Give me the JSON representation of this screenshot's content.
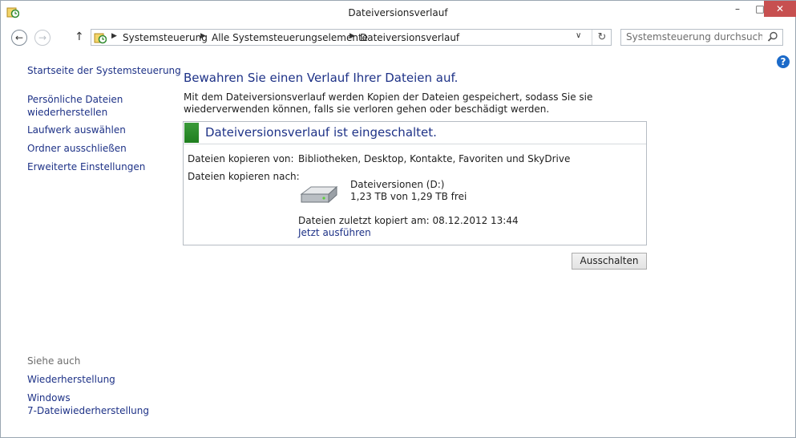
{
  "window": {
    "title": "Dateiversionsverlauf",
    "minimize": "–",
    "maximize": "□",
    "close": "✕"
  },
  "nav": {
    "back": "←",
    "forward": "→",
    "up": "↑",
    "breadcrumbs": [
      "Systemsteuerung",
      "Alle Systemsteuerungselemente",
      "Dateiversionsverlauf"
    ],
    "dropdown": "∨",
    "refresh": "↻",
    "search_placeholder": "Systemsteuerung durchsuchen"
  },
  "help": "?",
  "sidebar": {
    "home": "Startseite der Systemsteuerung",
    "links": [
      "Persönliche Dateien",
      "wiederherstellen",
      "Laufwerk auswählen",
      "Ordner ausschließen",
      "Erweiterte Einstellungen"
    ],
    "see_also": "Siehe auch",
    "see_also_links": [
      "Wiederherstellung",
      "Windows",
      "7-Dateiwiederherstellung"
    ]
  },
  "main": {
    "title": "Bewahren Sie einen Verlauf Ihrer Dateien auf.",
    "description": "Mit dem Dateiversionsverlauf werden Kopien der Dateien gespeichert, sodass Sie sie wiederverwenden können, falls sie verloren gehen oder beschädigt werden.",
    "status_title": "Dateiversionsverlauf ist eingeschaltet.",
    "copy_from_label": "Dateien kopieren von:",
    "copy_from_value": "Bibliotheken, Desktop, Kontakte, Favoriten und SkyDrive",
    "copy_to_label": "Dateien kopieren nach:",
    "drive_name": "Dateiversionen (D:)",
    "drive_space": "1,23 TB von 1,29 TB frei",
    "last_copied": "Dateien zuletzt kopiert am: 08.12.2012 13:44",
    "run_now": "Jetzt ausführen",
    "turn_off": "Ausschalten"
  },
  "colors": {
    "link": "#1e3287",
    "status_green": "#2b8c2b",
    "close_button": "#c75050"
  }
}
